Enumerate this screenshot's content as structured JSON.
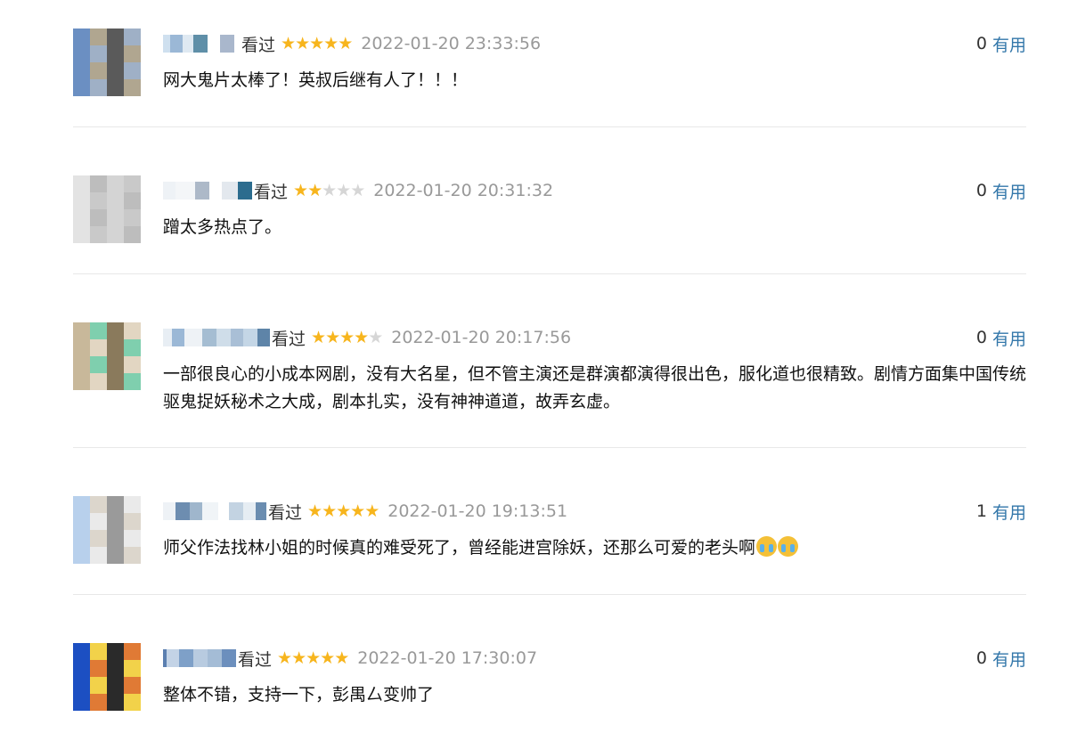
{
  "colors": {
    "star_filled": "#f7b51d",
    "star_empty": "#d6d6d6",
    "link": "#3377aa",
    "time": "#999999",
    "divider": "#e8e8e8"
  },
  "comments": [
    {
      "status": "看过",
      "rating": 5,
      "time": "2022-01-20 23:33:56",
      "useful_count": "0",
      "useful_label": "有用",
      "content": "网大鬼片太棒了！英叔后继有人了！！！",
      "avatar_colors": [
        "#6b8fc2",
        "#9fb0c6",
        "#5a5a5a",
        "#b0a690"
      ]
    },
    {
      "status": "看过",
      "rating": 2,
      "time": "2022-01-20 20:31:32",
      "useful_count": "0",
      "useful_label": "有用",
      "content": "蹭太多热点了。",
      "avatar_colors": [
        "#e3e3e3",
        "#c9c9c9",
        "#d4d4d4",
        "#bdbdbd"
      ]
    },
    {
      "status": "看过",
      "rating": 4,
      "time": "2022-01-20 20:17:56",
      "useful_count": "0",
      "useful_label": "有用",
      "content": "一部很良心的小成本网剧，没有大名星，但不管主演还是群演都演得很出色，服化道也很精致。剧情方面集中国传统驱鬼捉妖秘术之大成，剧本扎实，没有神神道道，故弄玄虚。",
      "avatar_colors": [
        "#c8b89a",
        "#e2d6c2",
        "#8a7a5c",
        "#7fcfae"
      ]
    },
    {
      "status": "看过",
      "rating": 5,
      "time": "2022-01-20 19:13:51",
      "useful_count": "1",
      "useful_label": "有用",
      "content": "师父作法找林小姐的时候真的难受死了，曾经能进宫除妖，还那么可爱的老头啊",
      "emoji": [
        "loudly-crying-emoji",
        "loudly-crying-emoji"
      ],
      "avatar_colors": [
        "#b8d0ec",
        "#eaeaea",
        "#9a9a9a",
        "#dcd6cc"
      ]
    },
    {
      "status": "看过",
      "rating": 5,
      "time": "2022-01-20 17:30:07",
      "useful_count": "0",
      "useful_label": "有用",
      "content": "整体不错，支持一下，彭禺厶变帅了",
      "avatar_colors": [
        "#1c4fc2",
        "#e07a35",
        "#2a2a2a",
        "#f2d24a"
      ]
    }
  ]
}
